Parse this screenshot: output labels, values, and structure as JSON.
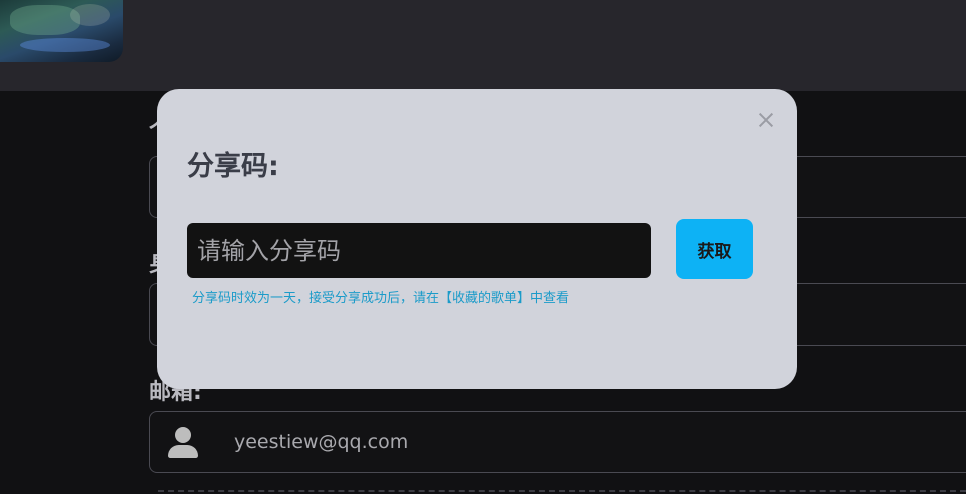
{
  "form": {
    "label_name_partial": "个",
    "label_id_partial": "身",
    "label_email": "邮箱:",
    "email_value": "yeestiew@qq.com"
  },
  "modal": {
    "title": "分享码:",
    "input_placeholder": "请输入分享码",
    "input_value": "",
    "hint": "分享码时效为一天，接受分享成功后，请在【收藏的歌单】中查看",
    "get_button_label": "获取",
    "close_icon": "close-icon"
  },
  "colors": {
    "accent": "#0db2f5",
    "hint": "#1b9bc9",
    "modal_bg": "#d1d3db",
    "page_bg": "#111113"
  }
}
